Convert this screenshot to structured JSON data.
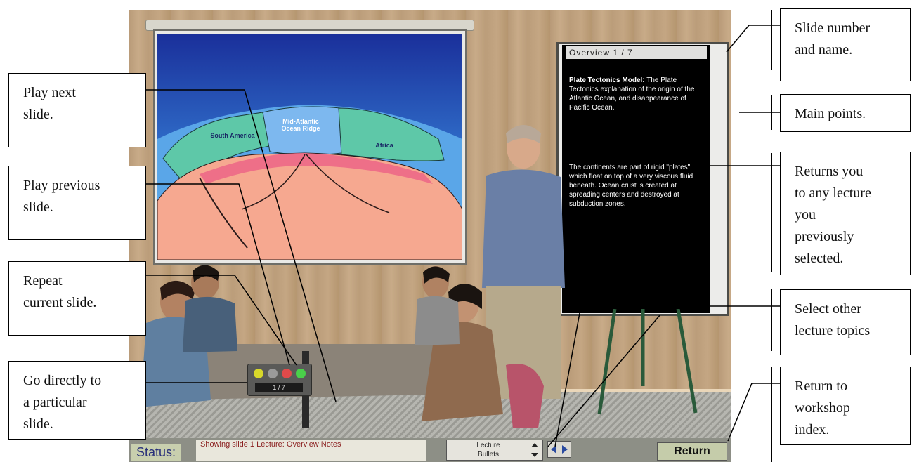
{
  "callouts": {
    "play_next": "Play next\nslide.",
    "play_previous": "Play previous\nslide.",
    "repeat_current": "Repeat\ncurrent slide.",
    "go_directly": "Go directly to\na particular\nslide.",
    "slide_number_name": "Slide number\nand name.",
    "main_points": "Main points.",
    "returns_lecture": "Returns you\nto any lecture\nyou\npreviously\nselected.",
    "select_topics": "Select other\nlecture topics",
    "return_index": "Return to\nworkshop\nindex."
  },
  "slide": {
    "number_name": "Overview 1 / 7",
    "heading": "Plate Tectonics Model:",
    "para1": "The Plate Tectonics explanation of the origin of the Atlantic Ocean, and disappearance of Pacific Ocean.",
    "para2": "The continents are part of rigid \"plates\" which float on top of a very viscous fluid beneath. Ocean crust is created at spreading centers and destroyed at subduction zones.",
    "labels": {
      "south_america": "South\nAmerica",
      "ridge": "Mid-Atlantic\nOcean\nRidge",
      "africa": "Africa"
    }
  },
  "console": {
    "readout": "1 / 7"
  },
  "statusbar": {
    "label": "Status:",
    "message": "Showing slide 1  Lecture: Overview  Notes",
    "lecture_option_1": "Lecture",
    "lecture_option_2": "Bullets",
    "return_label": "Return"
  },
  "colors": {
    "ocean_top": "#1e3aa6",
    "ocean_light": "#4aa0e6",
    "continent": "#5ec8a8",
    "mantle": "#f6a890",
    "magma": "#ee6f88",
    "status_text": "#8a1e1e",
    "button_green": "#c5ccaa"
  }
}
